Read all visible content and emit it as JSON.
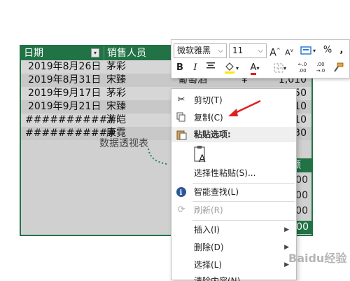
{
  "table": {
    "headers": [
      "日期",
      "销售人员"
    ],
    "rows": [
      {
        "date": "2019年8月26日",
        "person": "茅彩"
      },
      {
        "date": "2019年8月31日",
        "person": "宋臻"
      },
      {
        "date": "2019年9月17日",
        "person": "茅彩"
      },
      {
        "date": "2019年9月21日",
        "person": "宋臻"
      },
      {
        "date": "###########",
        "person": "游皑"
      },
      {
        "date": "###########",
        "person": "康霓"
      }
    ],
    "partial_product": "葡萄酒",
    "partial_currency": "¥",
    "partial_amount": "1,010",
    "right_values": [
      "50",
      "10",
      "10",
      "30"
    ],
    "pivot_header_partial": "额",
    "pivot_values": [
      "00",
      "00",
      "00",
      "00",
      "00"
    ],
    "pivot_placeholder": "数据透视表"
  },
  "mini_toolbar": {
    "font_name": "微软雅黑",
    "font_size": "11",
    "grow_font": "A",
    "shrink_font": "A",
    "percent": "%",
    "comma": ",",
    "bold": "B",
    "italic": "I",
    "font_color_label": "A",
    "decimal_increase": "←.0 .00",
    "decimal_decrease": ".00 →.0"
  },
  "context_menu": {
    "items": {
      "cut": "剪切(T)",
      "copy": "复制(C)",
      "paste_options": "粘贴选项:",
      "paste_special": "选择性粘贴(S)...",
      "smart_lookup": "智能查找(L)",
      "refresh": "刷新(R)",
      "insert": "插入(I)",
      "delete": "删除(D)",
      "select": "选择(L)",
      "clear": "清除内容(N)"
    },
    "submenu_arrow": "▶"
  },
  "watermark": "Baidu经验",
  "colors": {
    "excel_green": "#217346",
    "arrow_red": "#e02020"
  }
}
